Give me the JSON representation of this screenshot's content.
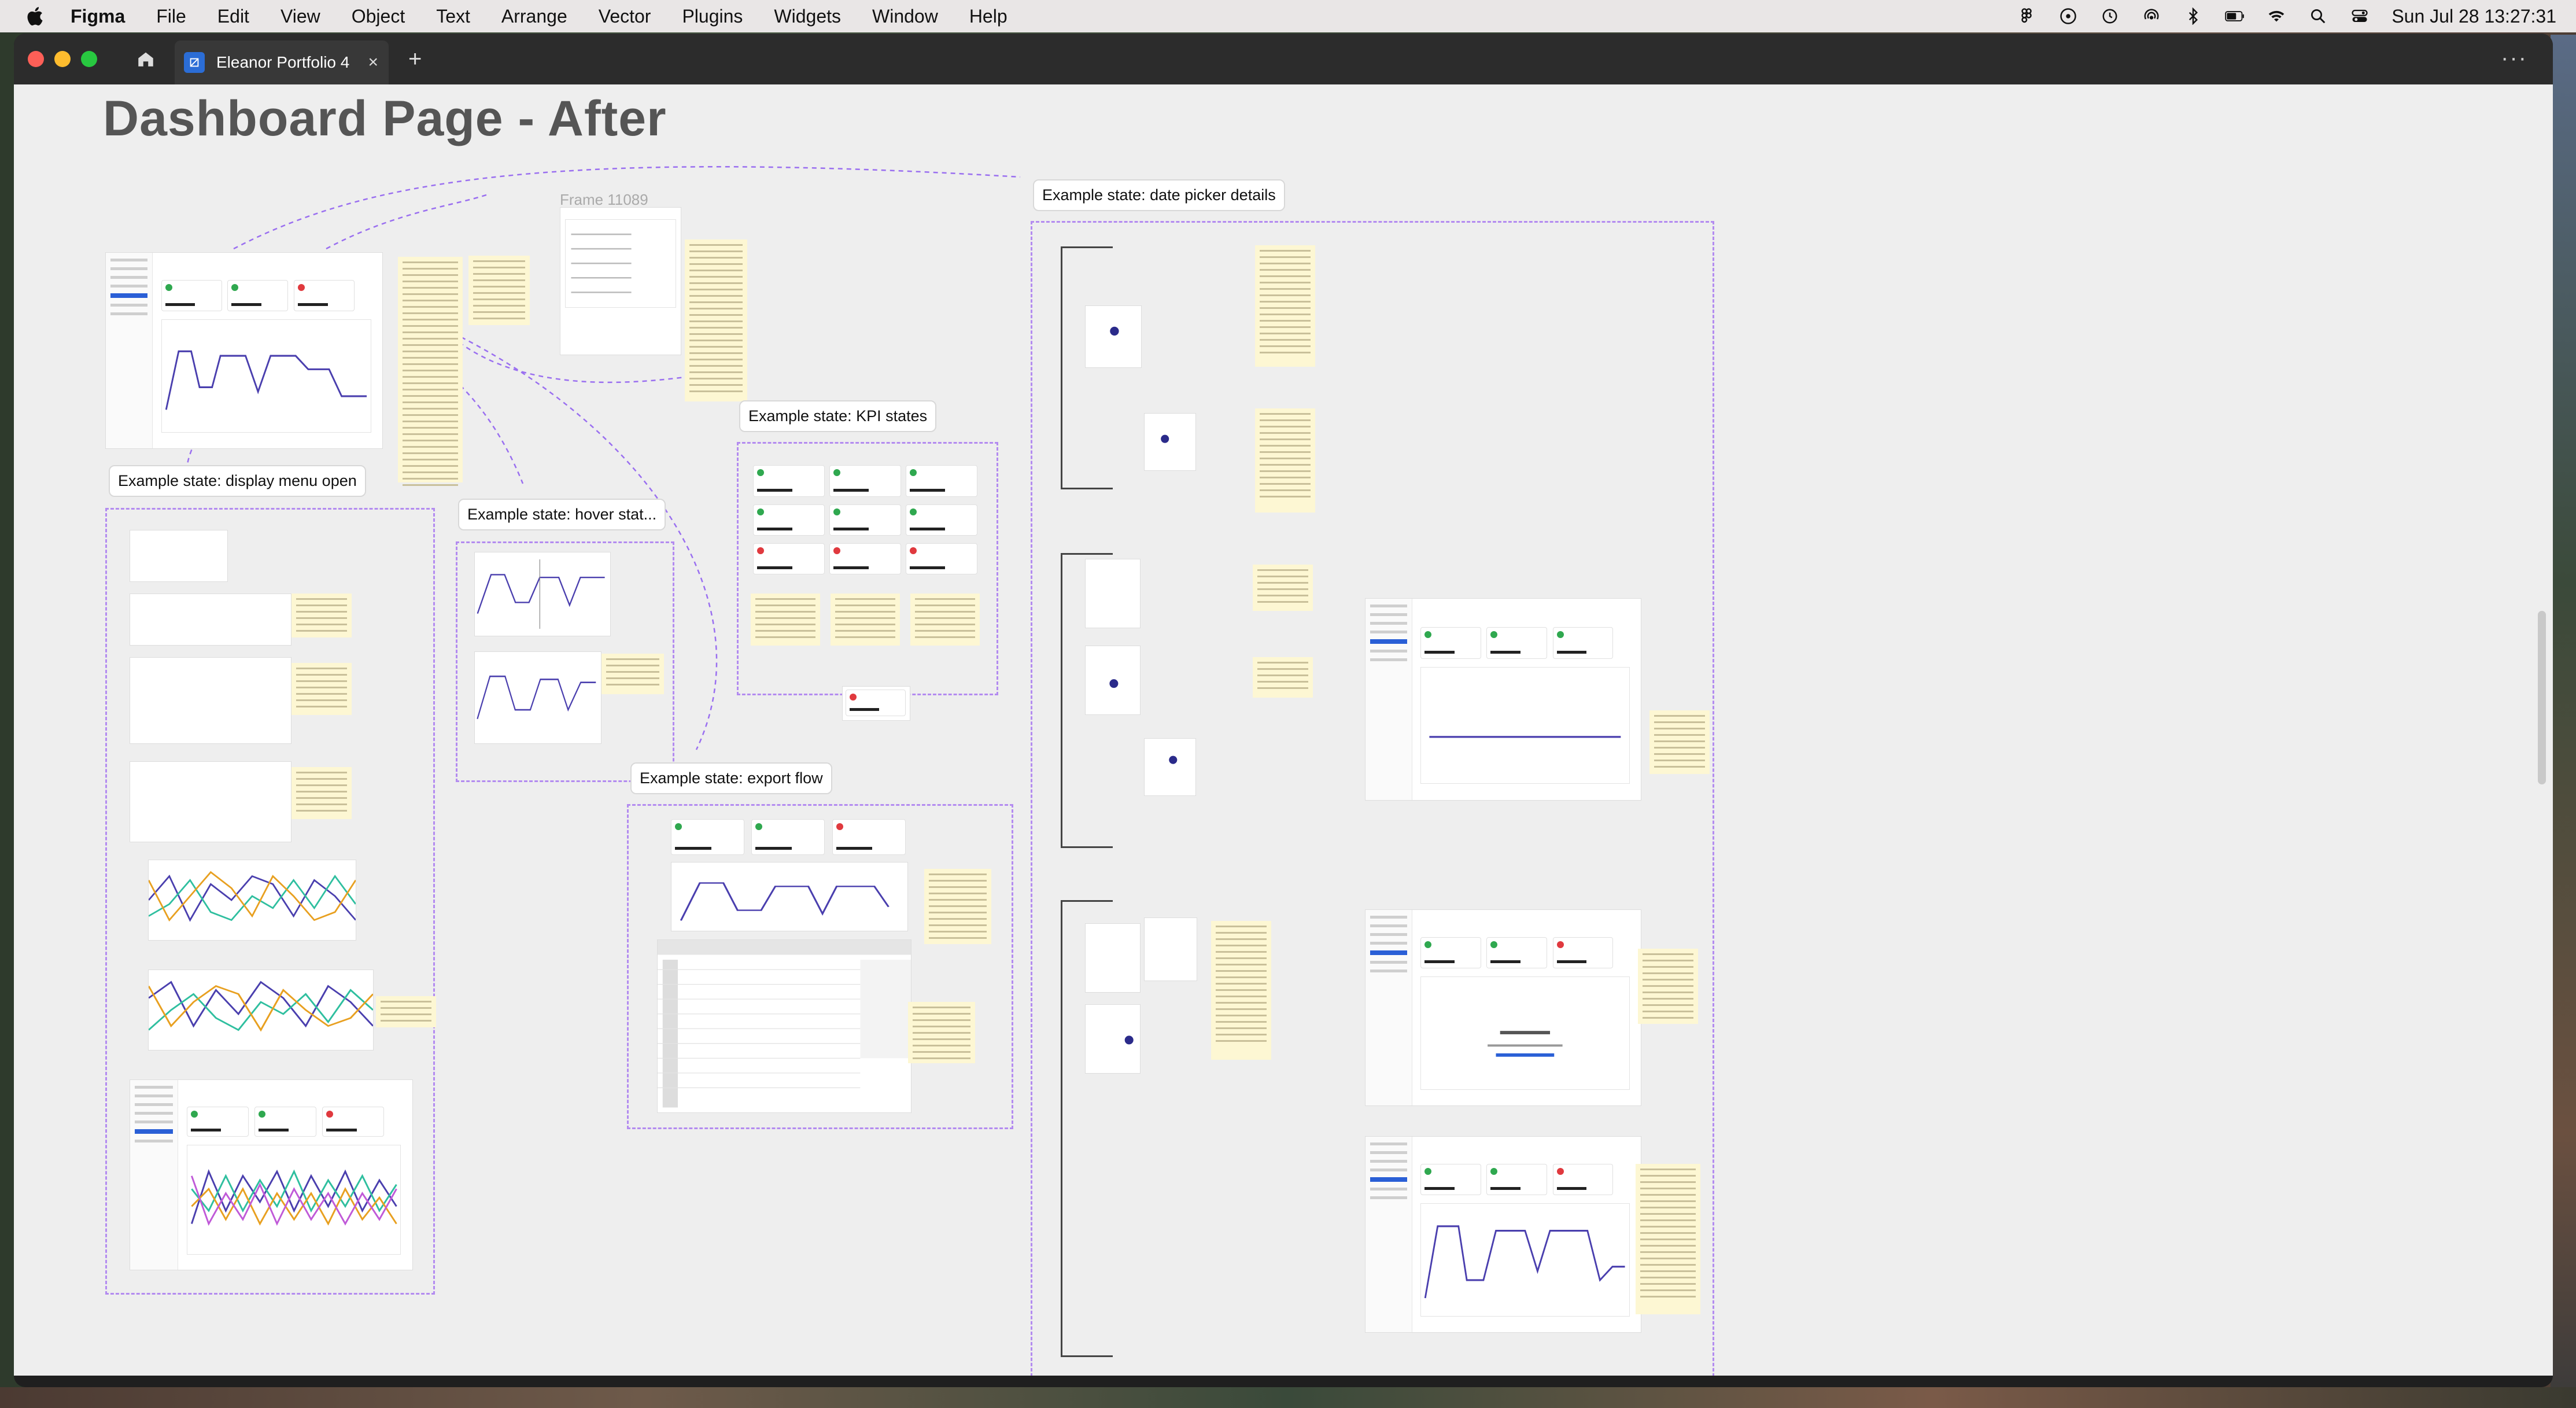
{
  "menubar": {
    "app_name": "Figma",
    "items": [
      "File",
      "Edit",
      "View",
      "Object",
      "Text",
      "Arrange",
      "Vector",
      "Plugins",
      "Widgets",
      "Window",
      "Help"
    ],
    "clock": "Sun Jul 28  13:27:31"
  },
  "window": {
    "tab_title": "Eleanor Portfolio 4",
    "tab_close": "×",
    "new_tab": "+",
    "more": "···"
  },
  "canvas": {
    "page_title": "Dashboard Page - After",
    "frame_name": "Frame 11089",
    "labels": {
      "date_picker": "Example state: date picker details",
      "kpi": "Example state: KPI states",
      "display_menu": "Example state: display menu open",
      "hover": "Example state: hover stat...",
      "export": "Example state: export flow"
    }
  },
  "colors": {
    "accent_dash": "#b38bf0",
    "chart_line": "#4a3fae",
    "kpi_green": "#2fa84f",
    "kpi_red": "#e0393e",
    "sticky": "#fdf7d3"
  },
  "icons": [
    "apple-icon",
    "figma-status-icon",
    "music-icon",
    "clock-icon",
    "airdrop-icon",
    "bluetooth-icon",
    "battery-icon",
    "wifi-icon",
    "search-icon",
    "control-center-icon",
    "home-icon",
    "figma-file-icon"
  ]
}
